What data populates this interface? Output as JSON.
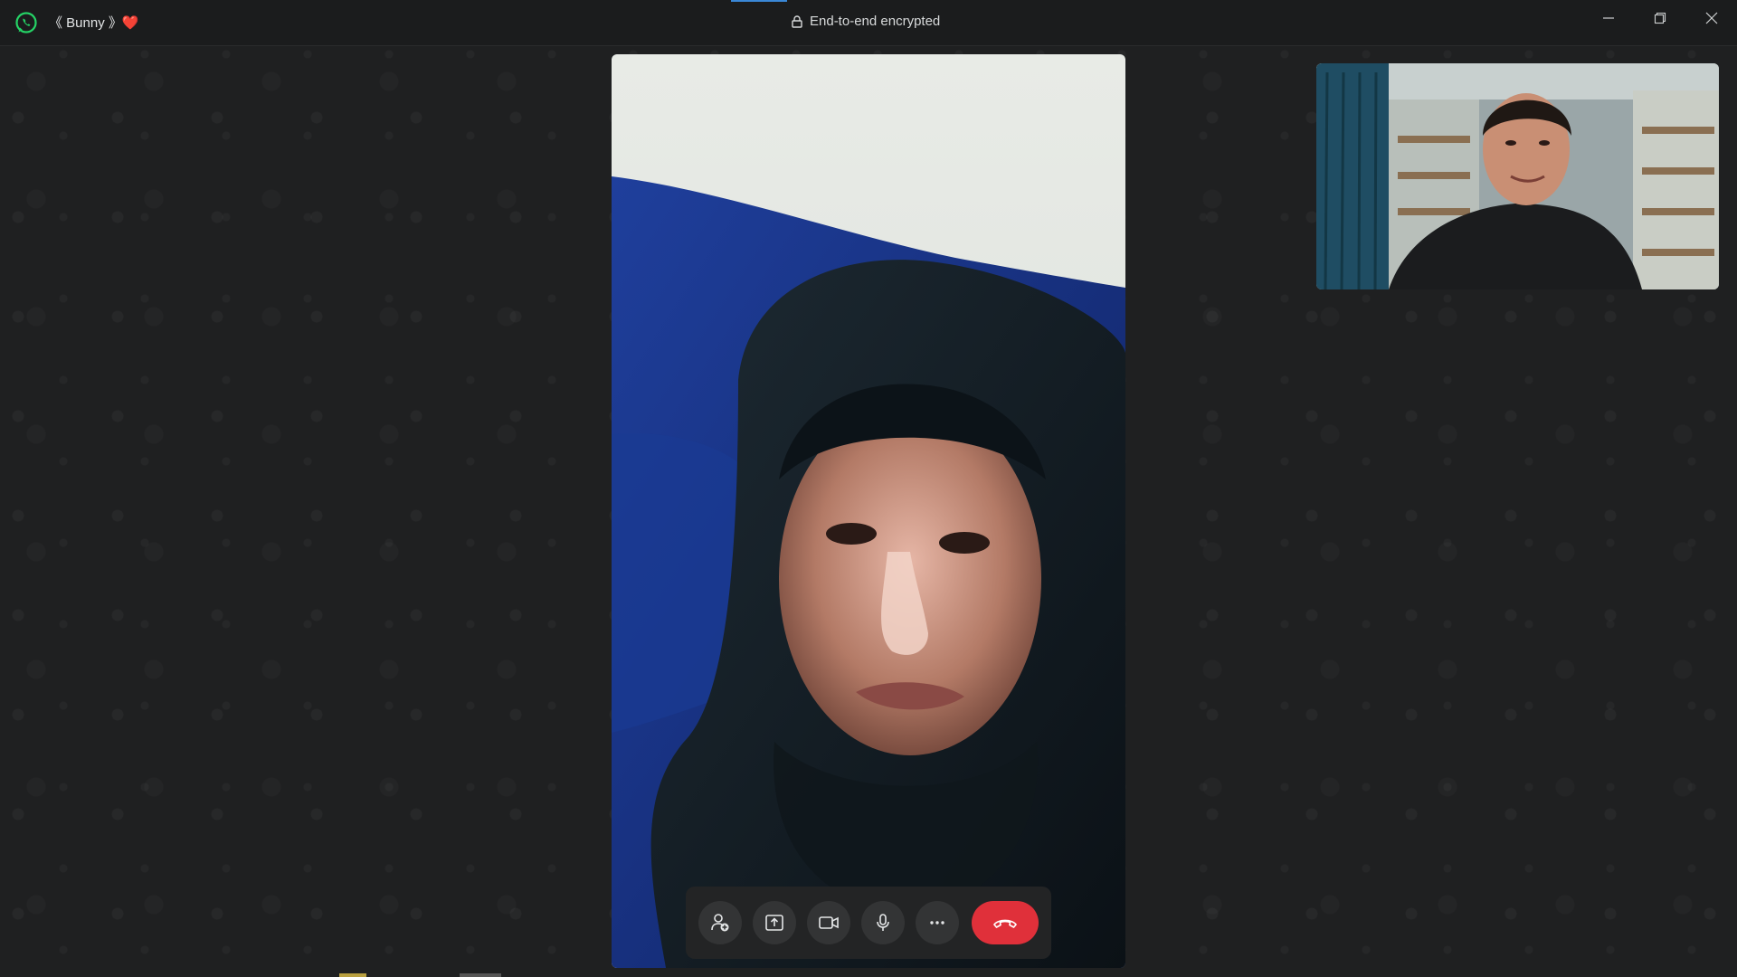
{
  "window": {
    "contact_name": "《 Bunny 》",
    "contact_emoji": "❤️",
    "encryption_label": "End-to-end encrypted",
    "controls": [
      "minimize",
      "restore",
      "close"
    ]
  },
  "colors": {
    "titlebar_bg": "#1b1c1d",
    "window_bg": "#1f2021",
    "whatsapp_green": "#25d366",
    "end_call_red": "#e0303a",
    "control_btn_bg": "#333435",
    "controls_bar_bg": "#232425"
  },
  "call": {
    "remote_video": "remote-participant-video",
    "self_video": "self-preview-video",
    "buttons": [
      {
        "id": "add-participant",
        "icon": "add-person-icon"
      },
      {
        "id": "share-screen",
        "icon": "screen-share-icon"
      },
      {
        "id": "camera",
        "icon": "video-camera-icon"
      },
      {
        "id": "microphone",
        "icon": "microphone-icon"
      },
      {
        "id": "more",
        "icon": "more-options-icon"
      },
      {
        "id": "end-call",
        "icon": "hang-up-icon"
      }
    ]
  }
}
